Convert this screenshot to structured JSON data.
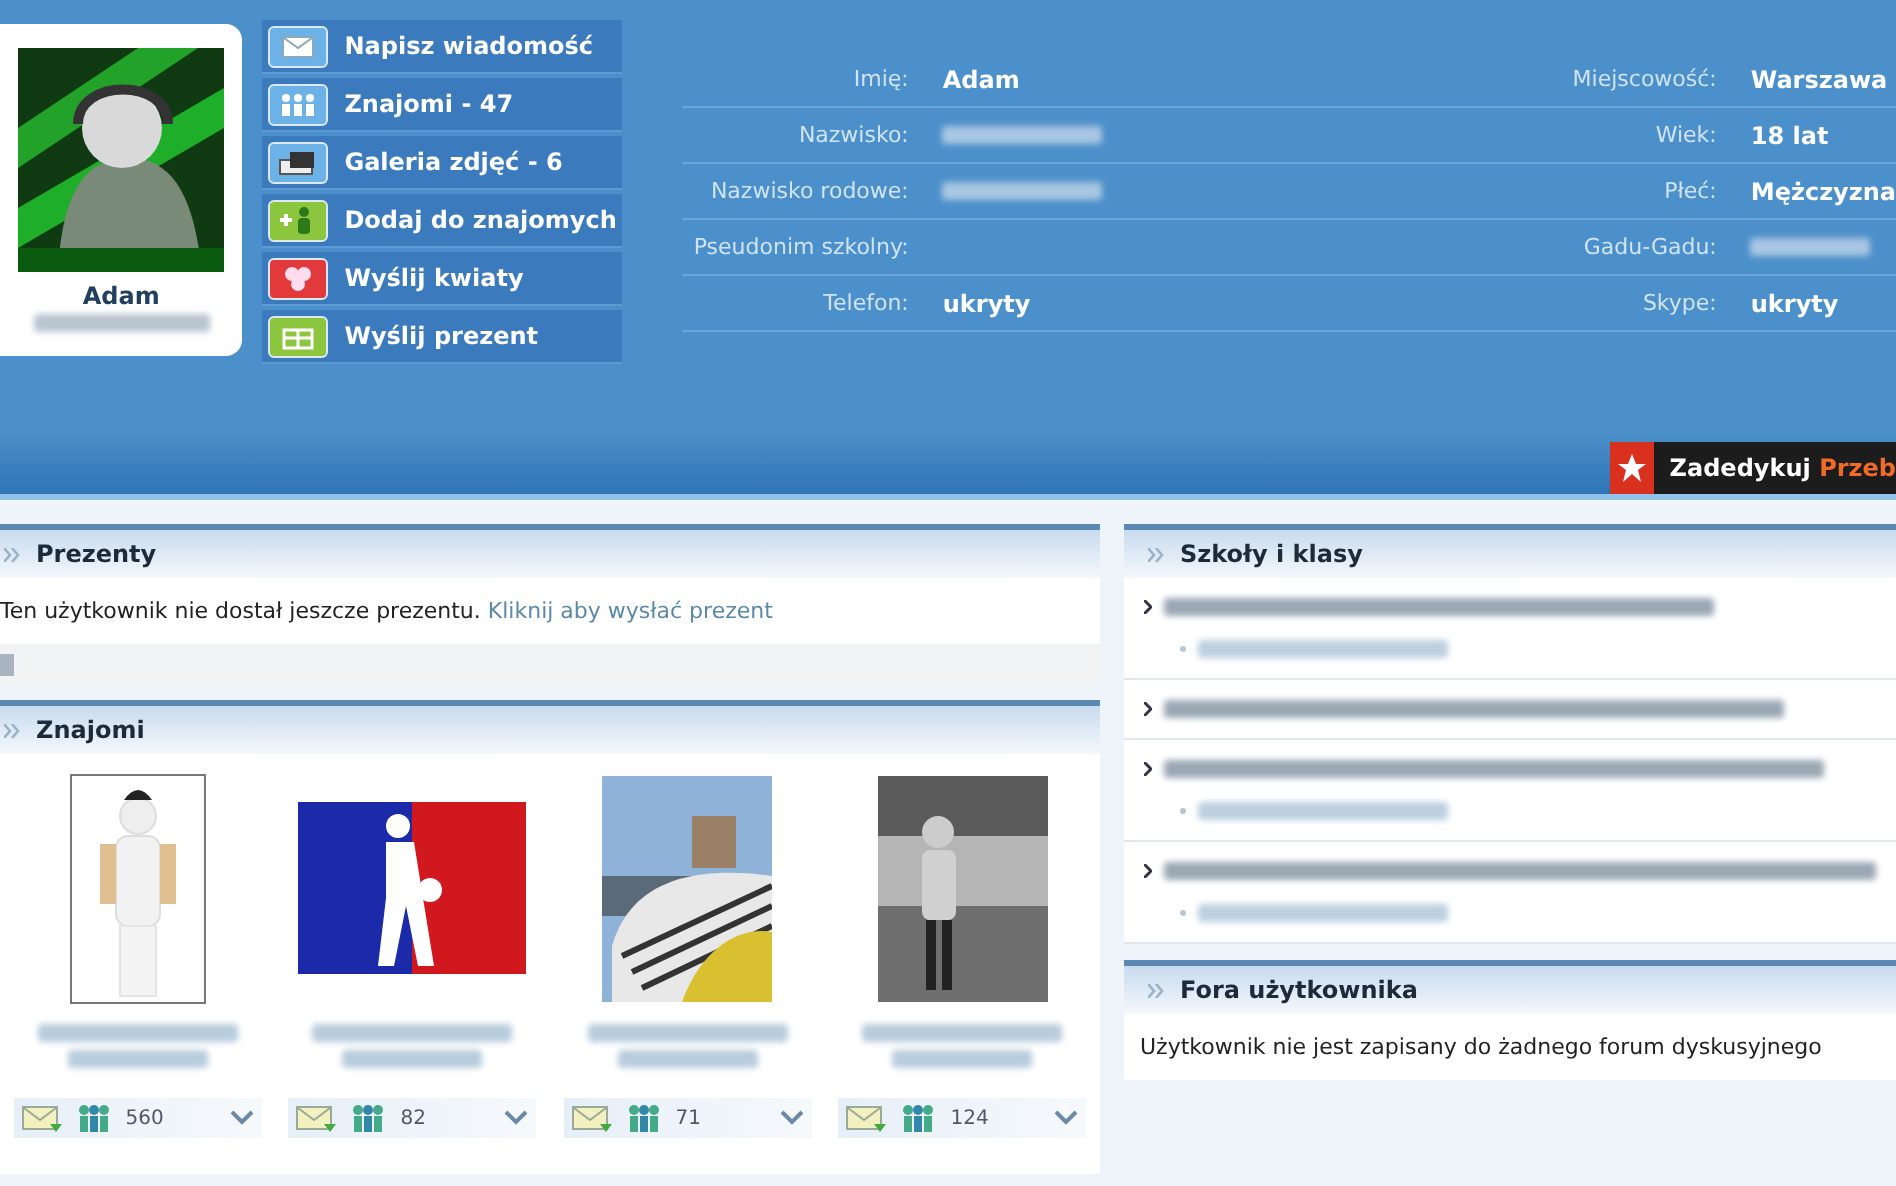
{
  "profile": {
    "name": "Adam",
    "surname_redacted": true
  },
  "actions": [
    {
      "label": "Napisz wiadomość",
      "kind": "message"
    },
    {
      "label": "Znajomi - 47",
      "kind": "friends"
    },
    {
      "label": "Galeria zdjęć - 6",
      "kind": "gallery"
    },
    {
      "label": "Dodaj do znajomych",
      "kind": "add"
    },
    {
      "label": "Wyślij kwiaty",
      "kind": "flowers"
    },
    {
      "label": "Wyślij prezent",
      "kind": "gift"
    }
  ],
  "details": [
    {
      "left": {
        "label": "Imię:",
        "value": "Adam"
      },
      "right": {
        "label": "Miejscowość:",
        "value": "Warszawa"
      }
    },
    {
      "left": {
        "label": "Nazwisko:",
        "redacted": true
      },
      "right": {
        "label": "Wiek:",
        "value": "18 lat"
      }
    },
    {
      "left": {
        "label": "Nazwisko rodowe:",
        "redacted": true
      },
      "right": {
        "label": "Płeć:",
        "value": "Mężczyzna"
      }
    },
    {
      "left": {
        "label": "Pseudonim szkolny:"
      },
      "right": {
        "label": "Gadu-Gadu:",
        "redacted": true
      }
    },
    {
      "left": {
        "label": "Telefon:",
        "value": "ukryty"
      },
      "right": {
        "label": "Skype:",
        "value": "ukryty"
      }
    }
  ],
  "dedicate_button": {
    "label": "Zadedykuj",
    "accent": "Przeb"
  },
  "gifts": {
    "title": "Prezenty",
    "message": "Ten użytkownik nie dostał jeszcze prezentu.",
    "link": "Kliknij aby wysłać prezent"
  },
  "friends": {
    "title": "Znajomi",
    "items": [
      {
        "kind": "figure",
        "name_redacted": true,
        "count": "560"
      },
      {
        "kind": "logo",
        "name_redacted": true,
        "count": "82"
      },
      {
        "name_redacted": true,
        "count": "71"
      },
      {
        "kind": "photo_bw",
        "name_redacted": true,
        "count": "124"
      }
    ]
  },
  "schools": {
    "title": "Szkoły i klasy",
    "items": [
      {
        "redacted": true,
        "children": [
          {
            "redacted": true
          }
        ]
      },
      {
        "redacted": true
      },
      {
        "redacted": true,
        "children": [
          {
            "redacted": true
          }
        ]
      },
      {
        "redacted": true,
        "children": [
          {
            "redacted": true
          }
        ]
      }
    ]
  },
  "forums": {
    "title": "Fora użytkownika",
    "message": "Użytkownik nie jest zapisany do żadnego forum dyskusyjnego"
  }
}
